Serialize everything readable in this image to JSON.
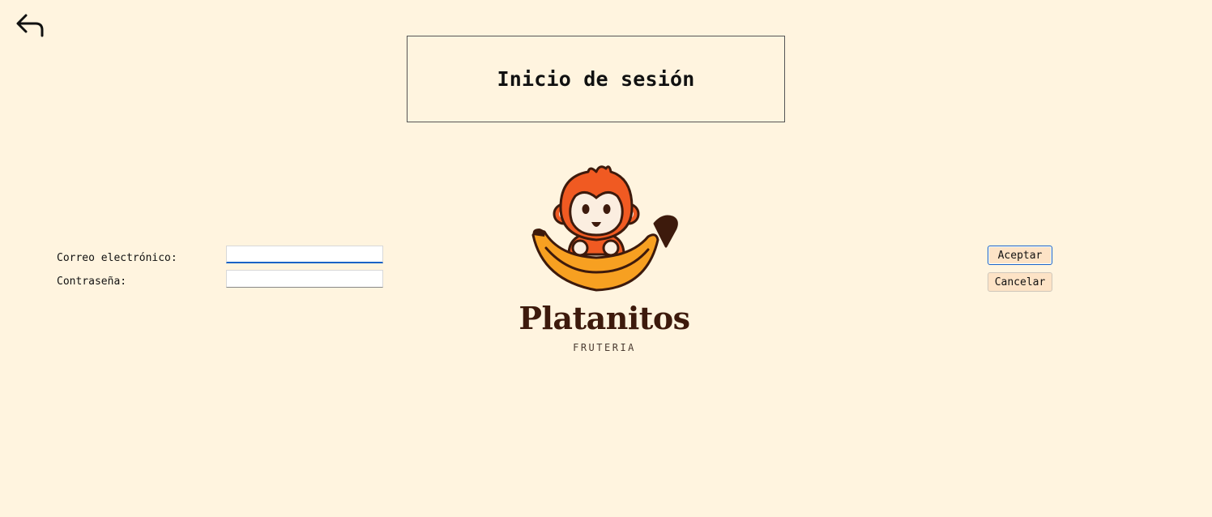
{
  "header": {
    "back_icon": "back-arrow-icon",
    "title": "Inicio de sesión"
  },
  "form": {
    "email_label": "Correo electrónico:",
    "email_value": "",
    "password_label": "Contraseña:",
    "password_value": ""
  },
  "actions": {
    "accept_label": "Aceptar",
    "cancel_label": "Cancelar"
  },
  "brand": {
    "name": "Platanitos",
    "tagline": "FRUTERIA",
    "mascot": "monkey-on-banana-logo",
    "colors": {
      "orange": "#f05a22",
      "banana": "#f7a021",
      "dark_brown": "#3d1a0c",
      "face": "#fbeee0"
    }
  },
  "colors": {
    "background": "#fff4df",
    "button_bg": "#fde3c6",
    "focus_blue": "#1a63c6"
  }
}
